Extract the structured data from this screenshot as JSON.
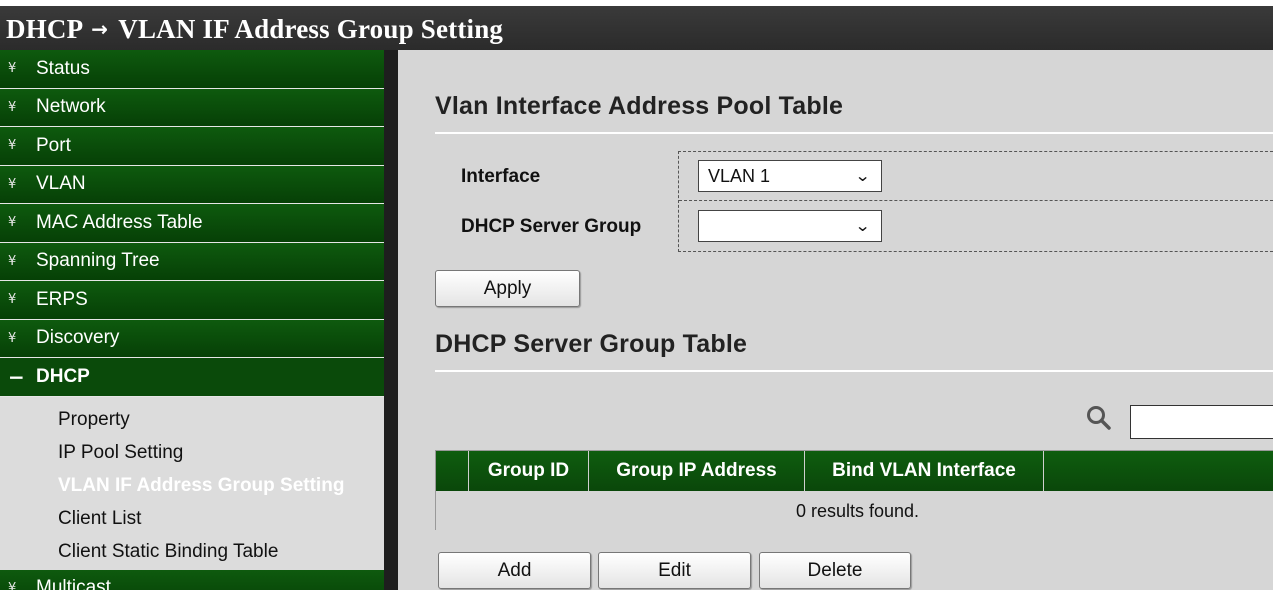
{
  "header": {
    "section": "DHCP",
    "arrow": "→",
    "page": "VLAN IF Address Group Setting"
  },
  "sidebar": {
    "items_top": [
      {
        "label": "Status"
      },
      {
        "label": "Network"
      },
      {
        "label": "Port"
      },
      {
        "label": "VLAN"
      },
      {
        "label": "MAC Address Table"
      },
      {
        "label": "Spanning Tree"
      },
      {
        "label": "ERPS"
      },
      {
        "label": "Discovery"
      }
    ],
    "expanded": {
      "label": "DHCP",
      "bullet": "−"
    },
    "subitems": [
      {
        "label": "Property"
      },
      {
        "label": "IP Pool Setting"
      },
      {
        "label": "VLAN IF Address Group Setting"
      },
      {
        "label": "Client List"
      },
      {
        "label": "Client Static Binding Table"
      }
    ],
    "items_bottom": [
      {
        "label": "Multicast"
      }
    ],
    "bullet": "¥"
  },
  "pool_table": {
    "title": "Vlan Interface Address Pool Table",
    "interface_label": "Interface",
    "interface_value": "VLAN 1",
    "server_group_label": "DHCP Server Group",
    "server_group_value": "",
    "apply_label": "Apply"
  },
  "group_table": {
    "title": "DHCP Server Group Table",
    "search_value": "",
    "columns": [
      "Group ID",
      "Group IP Address",
      "Bind VLAN Interface"
    ],
    "empty_text": "0 results found.",
    "add_label": "Add",
    "edit_label": "Edit",
    "delete_label": "Delete"
  },
  "icons": {
    "search": "search-icon",
    "dropdown": "chevron-down-icon"
  },
  "colors": {
    "nav_green": "#0e5a0e",
    "title_bar": "#2b2b2b",
    "content_bg": "#d6d6d6"
  }
}
